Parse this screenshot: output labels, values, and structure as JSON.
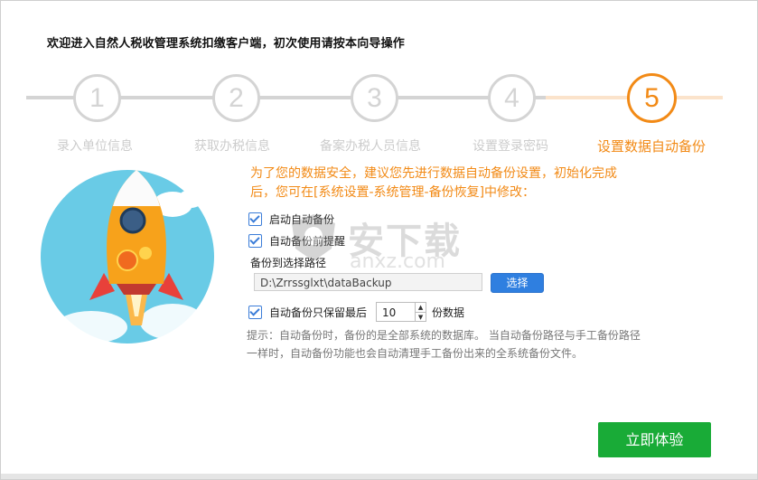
{
  "header": {
    "welcome": "欢迎进入自然人税收管理系统扣缴客户端，初次使用请按本向导操作"
  },
  "steps": [
    {
      "number": "1",
      "label": "录入单位信息",
      "active": false
    },
    {
      "number": "2",
      "label": "获取办税信息",
      "active": false
    },
    {
      "number": "3",
      "label": "备案办税人员信息",
      "active": false
    },
    {
      "number": "4",
      "label": "设置登录密码",
      "active": false
    },
    {
      "number": "5",
      "label": "设置数据自动备份",
      "active": true
    }
  ],
  "form": {
    "notice": "为了您的数据安全，建议您先进行数据自动备份设置，初始化完成后，您可在[系统设置-系统管理-备份恢复]中修改：",
    "auto_backup_label": "启动自动备份",
    "pre_backup_reminder_label": "自动备份前提醒",
    "path_label": "备份到选择路径",
    "path_value": "D:\\Zrrssglxt\\dataBackup",
    "select_button": "选择",
    "keep_last_label": "自动备份只保留最后",
    "keep_last_value": "10",
    "keep_last_unit": "份数据",
    "hint": "提示：自动备份时，备份的是全部系统的数据库。 当自动备份路径与手工备份路径一样时，自动备份功能也会自动清理手工备份出来的全系统备份文件。",
    "submit_button": "立即体验"
  },
  "watermark": {
    "text": "安下载",
    "sub": "anxz.com"
  },
  "colors": {
    "accent": "#f28a16",
    "primary_button": "#19ab37",
    "select_button": "#2f7fe0",
    "inactive": "#d4d4d4"
  }
}
